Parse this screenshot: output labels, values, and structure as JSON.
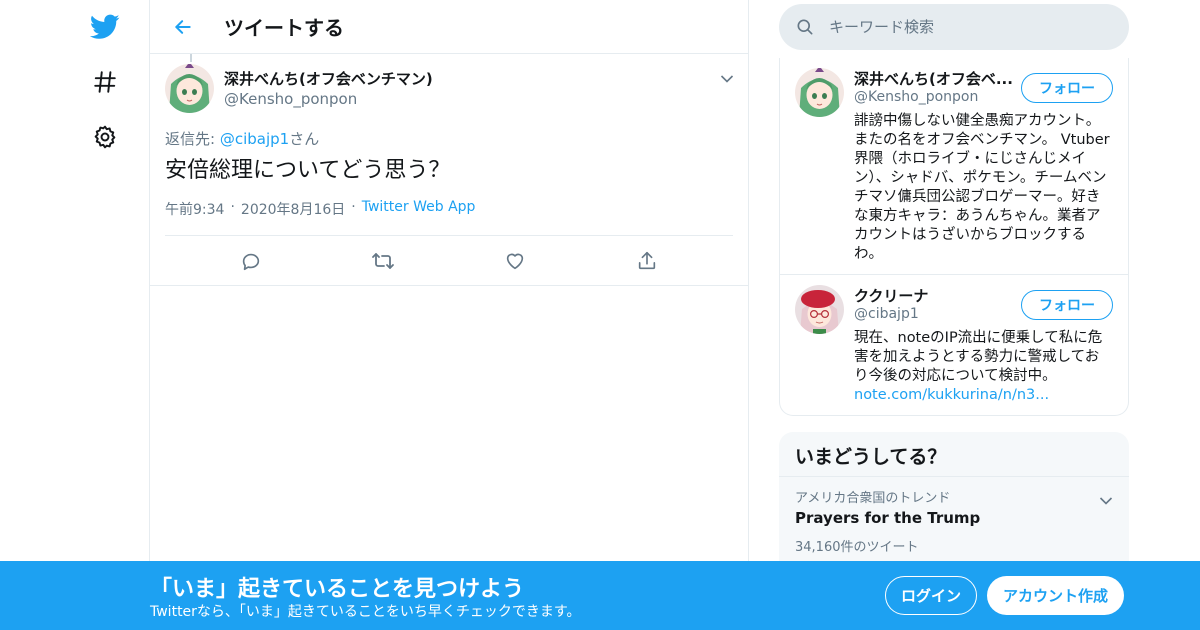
{
  "colors": {
    "accent": "#1da1f2",
    "muted": "#657786",
    "border": "#e6ecf0"
  },
  "nav": {
    "icons": [
      "twitter-bird-icon",
      "hashtag-icon",
      "gear-icon"
    ]
  },
  "header": {
    "title": "ツイートする"
  },
  "tweet": {
    "author_name": "深井べんち(オフ会ベンチマン)",
    "author_handle": "@Kensho_ponpon",
    "reply_prefix": "返信先: ",
    "reply_to": "@cibajp1",
    "reply_suffix": "さん",
    "text": "安倍総理についてどう思う？",
    "time": "午前9:34",
    "date": "2020年8月16日",
    "source": "Twitter Web App",
    "separator": "·"
  },
  "search": {
    "placeholder": "キーワード検索"
  },
  "users": [
    {
      "name": "深井べんち(オフ会ベ...",
      "handle": "@Kensho_ponpon",
      "follow_label": "フォロー",
      "bio": "誹謗中傷しない健全愚痴アカウント。またの名をオフ会ベンチマン。 Vtuber界隈（ホロライブ・にじさんじメイン）、シャドバ、ポケモン。チームベンチマソ傭兵団公認ブロゲーマー。好きな東方キャラ：あうんちゃん。業者アカウントはうざいからブロックするわ。",
      "link": ""
    },
    {
      "name": "ククリーナ",
      "handle": "@cibajp1",
      "follow_label": "フォロー",
      "bio": "現在、noteのIP流出に便乗して私に危害を加えようとする勢力に警戒しており今後の対応について検討中。",
      "link": "note.com/kukkurina/n/n3..."
    }
  ],
  "trends": {
    "title": "いまどうしてる？",
    "items": [
      {
        "category": "アメリカ合衆国のトレンド",
        "name": "Prayers for the Trump",
        "count": "34,160件のツイート"
      }
    ]
  },
  "bottom_bar": {
    "title": "「いま」起きていることを見つけよう",
    "subtitle": "Twitterなら、「いま」起きていることをいち早くチェックできます。",
    "login": "ログイン",
    "signup": "アカウント作成"
  }
}
